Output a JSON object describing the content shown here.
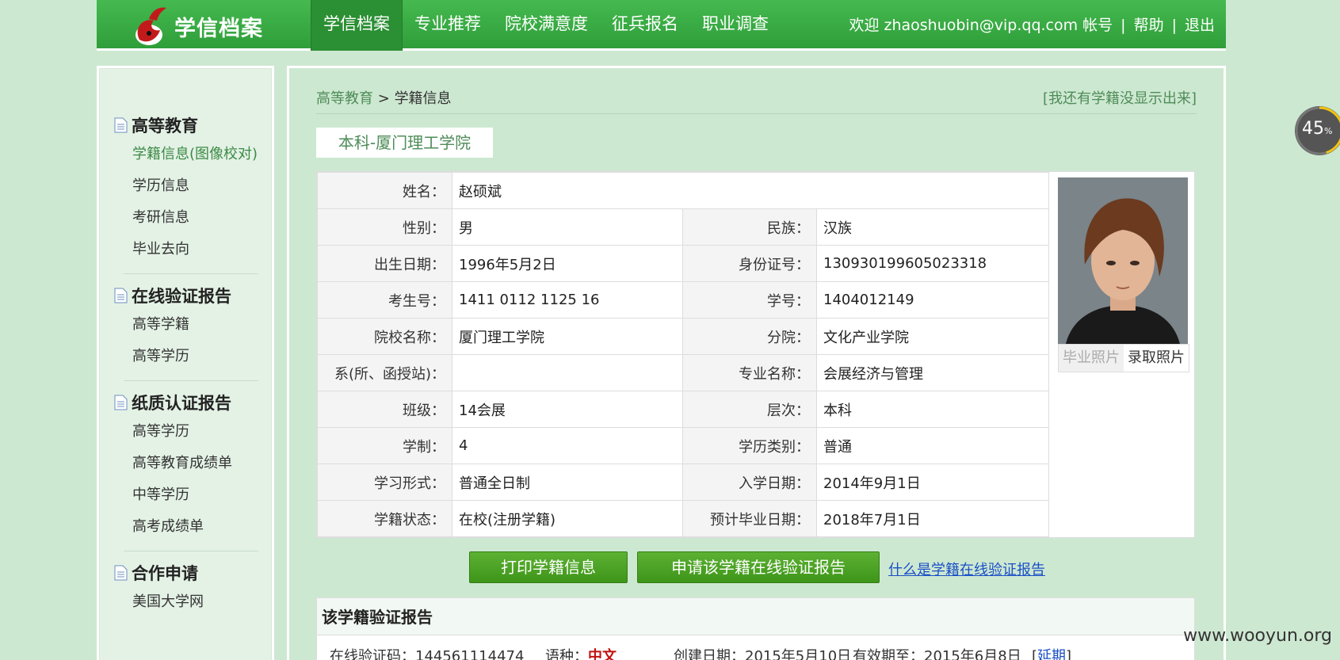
{
  "header": {
    "site_title": "学信档案",
    "nav": [
      "学信档案",
      "专业推荐",
      "院校满意度",
      "征兵报名",
      "职业调查"
    ],
    "welcome": "欢迎 zhaoshuobin@vip.qq.com",
    "account": "帐号",
    "help": "帮助",
    "logout": "退出",
    "sep": "|"
  },
  "sidebar": {
    "sections": [
      {
        "title": "高等教育",
        "items": [
          "学籍信息(图像校对)",
          "学历信息",
          "考研信息",
          "毕业去向"
        ]
      },
      {
        "title": "在线验证报告",
        "items": [
          "高等学籍",
          "高等学历"
        ]
      },
      {
        "title": "纸质认证报告",
        "items": [
          "高等学历",
          "高等教育成绩单",
          "中等学历",
          "高考成绩单"
        ]
      },
      {
        "title": "合作申请",
        "items": [
          "美国大学网"
        ]
      }
    ]
  },
  "main": {
    "breadcrumb_root": "高等教育",
    "breadcrumb_sep": ">",
    "breadcrumb_current": "学籍信息",
    "missing_link": "[我还有学籍没显示出来]",
    "school_tab": "本科-厦门理工学院",
    "fields": {
      "name_label": "姓名：",
      "name": "赵硕斌",
      "gender_label": "性别：",
      "gender": "男",
      "ethnic_label": "民族：",
      "ethnic": "汉族",
      "birth_label": "出生日期：",
      "birth": "1996年5月2日",
      "id_label": "身份证号：",
      "id": "130930199605023318",
      "exam_label": "考生号：",
      "exam": "1411 0112 1125 16",
      "stuno_label": "学号：",
      "stuno": "1404012149",
      "school_label": "院校名称：",
      "school": "厦门理工学院",
      "branch_label": "分院：",
      "branch": "文化产业学院",
      "dept_label": "系(所、函授站)：",
      "dept": "",
      "major_label": "专业名称：",
      "major": "会展经济与管理",
      "class_label": "班级：",
      "class": "14会展",
      "level_label": "层次：",
      "level": "本科",
      "duration_label": "学制：",
      "duration": "4",
      "type_label": "学历类别：",
      "type": "普通",
      "form_label": "学习形式：",
      "form": "普通全日制",
      "enroll_label": "入学日期：",
      "enroll": "2014年9月1日",
      "status_label": "学籍状态：",
      "status": "在校(注册学籍)",
      "grad_label": "预计毕业日期：",
      "grad": "2018年7月1日"
    },
    "photo_tabs": [
      "毕业照片",
      "录取照片"
    ],
    "print_button": "打印学籍信息",
    "apply_button": "申请该学籍在线验证报告",
    "what_link": "什么是学籍在线验证报告",
    "report": {
      "title": "该学籍验证报告",
      "code_label": "在线验证码：",
      "code": "144561114474",
      "lang_label": "语种：",
      "lang": "中文",
      "created_label": "创建日期：",
      "created": "2015年5月10日",
      "valid_label": "有效期至：",
      "valid": "2015年6月8日",
      "extend": "延期",
      "bracket_open": "[",
      "bracket_close": "]"
    }
  },
  "progress": {
    "value": "45",
    "unit": "%",
    "fraction": 0.45
  },
  "watermark": "www.wooyun.org"
}
